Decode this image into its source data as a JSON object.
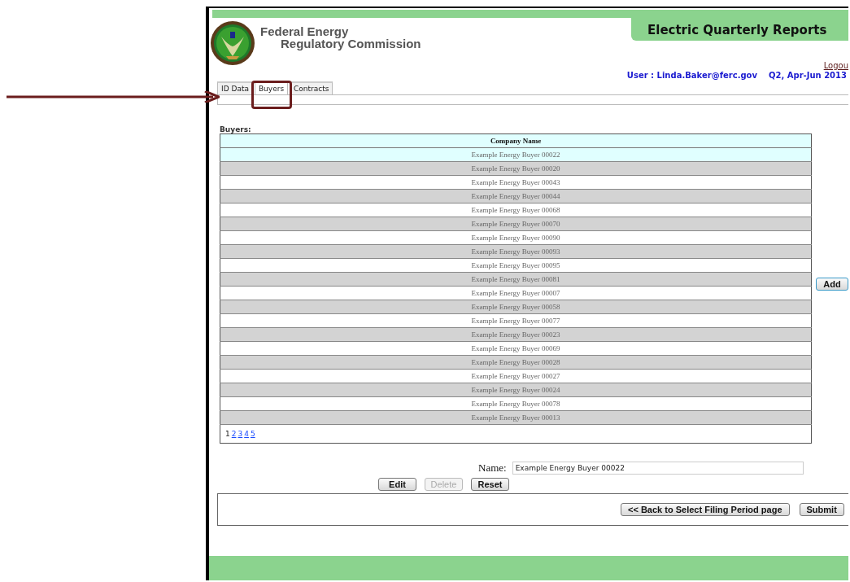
{
  "header": {
    "org_line_1": "Federal Energy",
    "org_line_2": "Regulatory Commission",
    "title": "Electric Quarterly Reports",
    "logout": "Logou",
    "user": "User : Linda.Baker@ferc.gov",
    "period": "Q2, Apr-Jun 2013"
  },
  "tabs": [
    {
      "label": "ID Data",
      "selected": false
    },
    {
      "label": "Buyers",
      "selected": true
    },
    {
      "label": "Contracts",
      "selected": false
    }
  ],
  "section_label": "Buyers:",
  "table": {
    "columns": [
      "Company Name"
    ],
    "rows": [
      {
        "name": "Example Energy Buyer 00022",
        "selected": true
      },
      {
        "name": "Example Energy Buyer 00020",
        "selected": false
      },
      {
        "name": "Example Energy Buyer 00043",
        "selected": false
      },
      {
        "name": "Example Energy Buyer 00044",
        "selected": false
      },
      {
        "name": "Example Energy Buyer 00068",
        "selected": false
      },
      {
        "name": "Example Energy Buyer 00070",
        "selected": false
      },
      {
        "name": "Example Energy Buyer 00090",
        "selected": false
      },
      {
        "name": "Example Energy Buyer 00093",
        "selected": false
      },
      {
        "name": "Example Energy Buyer 00095",
        "selected": false
      },
      {
        "name": "Example Energy Buyer 00081",
        "selected": false
      },
      {
        "name": "Example Energy Buyer 00007",
        "selected": false
      },
      {
        "name": "Example Energy Buyer 00058",
        "selected": false
      },
      {
        "name": "Example Energy Buyer 00077",
        "selected": false
      },
      {
        "name": "Example Energy Buyer 00023",
        "selected": false
      },
      {
        "name": "Example Energy Buyer 00069",
        "selected": false
      },
      {
        "name": "Example Energy Buyer 00028",
        "selected": false
      },
      {
        "name": "Example Energy Buyer 00027",
        "selected": false
      },
      {
        "name": "Example Energy Buyer 00024",
        "selected": false
      },
      {
        "name": "Example Energy Buyer 00078",
        "selected": false
      },
      {
        "name": "Example Energy Buyer 00013",
        "selected": false
      }
    ],
    "pages": [
      {
        "label": "1",
        "selected": true
      },
      {
        "label": "2",
        "selected": false
      },
      {
        "label": "3",
        "selected": false
      },
      {
        "label": "4",
        "selected": false
      },
      {
        "label": "5",
        "selected": false
      }
    ]
  },
  "add_button": "Add",
  "name_field": {
    "label": "Name:",
    "value": "Example Energy Buyer 00022"
  },
  "actions": [
    {
      "label": "Edit",
      "disabled": false
    },
    {
      "label": "Delete",
      "disabled": true
    },
    {
      "label": "Reset",
      "disabled": false
    }
  ],
  "footer_buttons": [
    "<< Back to Select Filing Period page",
    "Submit"
  ]
}
